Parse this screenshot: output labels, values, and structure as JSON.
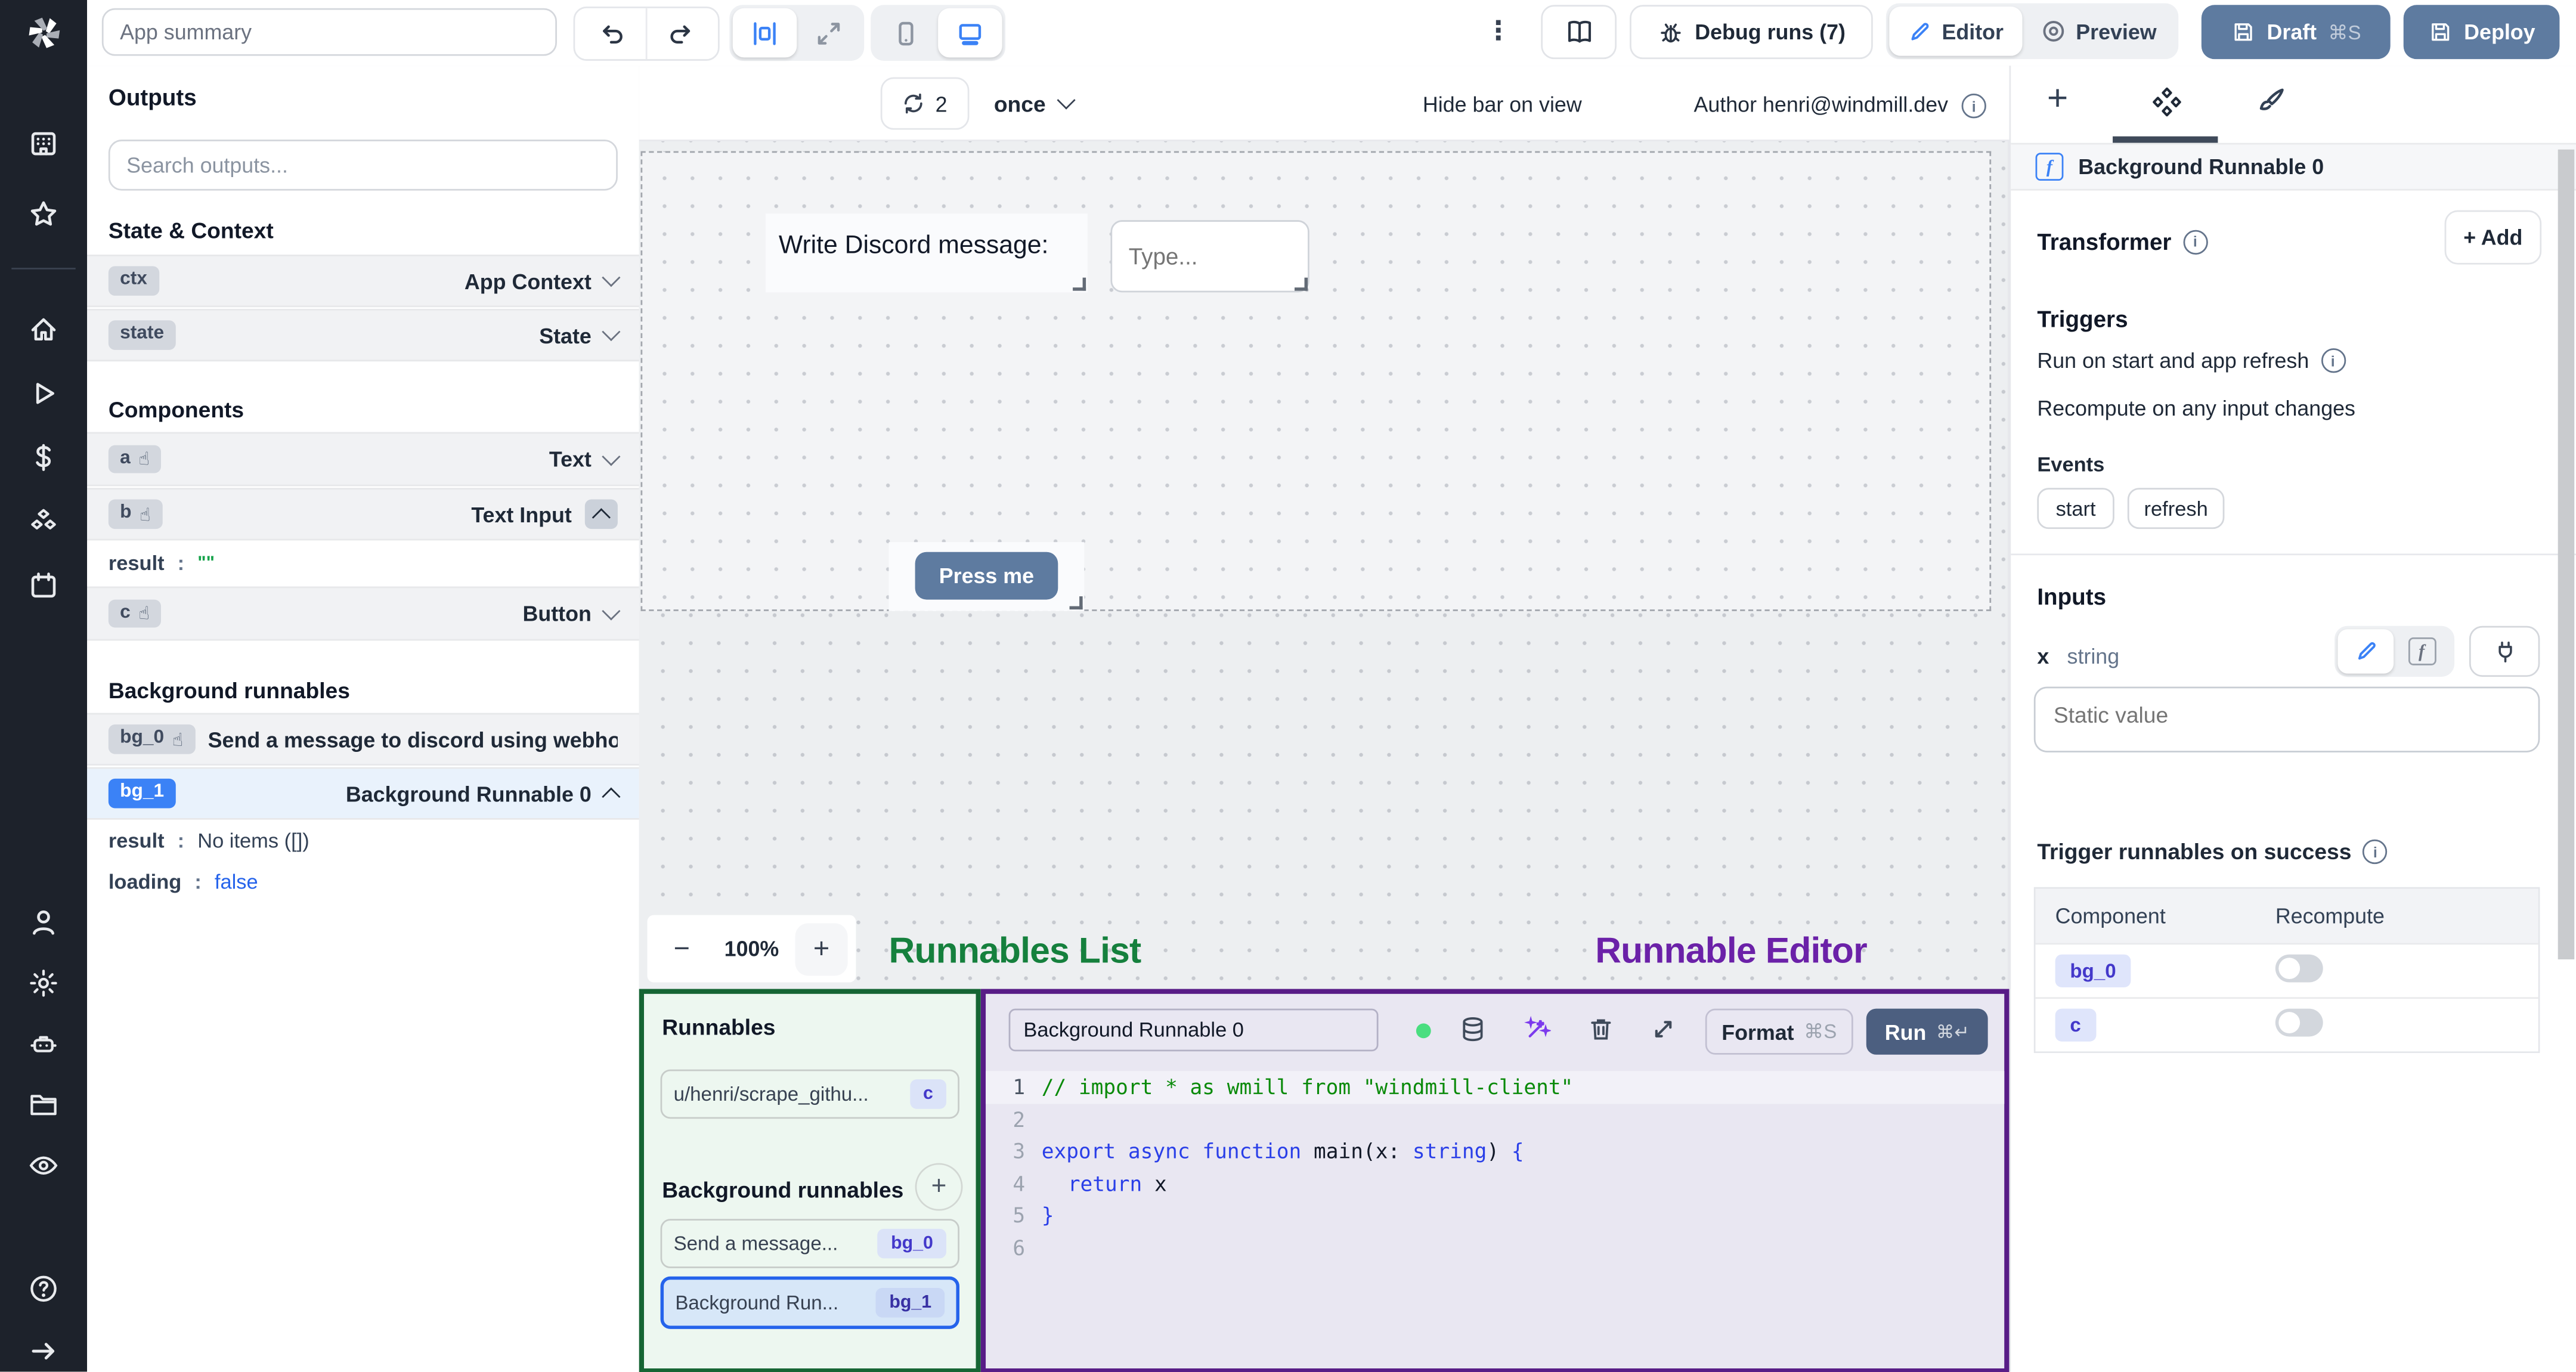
{
  "symbols": {
    "plus": "+",
    "minus": "−",
    "kebab": "⋮",
    "hand": "☝",
    "colon": ":"
  },
  "topbar": {
    "app_summary_placeholder": "App summary",
    "debug_runs": "Debug runs (7)",
    "editor": "Editor",
    "preview": "Preview",
    "draft": "Draft",
    "draft_shortcut": "⌘S",
    "deploy": "Deploy"
  },
  "canvas_toolbar": {
    "refresh_count": "2",
    "mode": "once",
    "hide_bar_label": "Hide bar on view",
    "author": "Author henri@windmill.dev"
  },
  "outputs": {
    "title": "Outputs",
    "search_placeholder": "Search outputs...",
    "state_context_title": "State & Context",
    "rows": [
      {
        "badge": "ctx",
        "label": "App Context"
      },
      {
        "badge": "state",
        "label": "State"
      }
    ],
    "components_title": "Components",
    "comp_rows": [
      {
        "badge": "a",
        "label": "Text"
      },
      {
        "badge": "b",
        "label": "Text Input"
      },
      {
        "badge": "c",
        "label": "Button"
      }
    ],
    "b_result_key": "result",
    "b_result_value": "\"\"",
    "bg_title": "Background runnables",
    "bg0_badge": "bg_0",
    "bg0_label": "Send a message to discord using webhoo",
    "bg1_badge": "bg_1",
    "bg1_label": "Background Runnable 0",
    "bg1_result_key": "result",
    "bg1_result_value": "No items ([])",
    "bg1_loading_key": "loading",
    "bg1_loading_value": "false"
  },
  "canvas": {
    "text_component": "Write Discord message:",
    "input_placeholder": "Type...",
    "button_label": "Press me",
    "zoom_level": "100%"
  },
  "annotations": {
    "runnables_list": "Runnables List",
    "runnable_editor": "Runnable Editor"
  },
  "runnables_panel": {
    "title": "Runnables",
    "item1_label": "u/henri/scrape_githu...",
    "item1_badge": "c",
    "bg_title": "Background runnables",
    "item2_label": "Send a message...",
    "item2_badge": "bg_0",
    "item3_label": "Background Run...",
    "item3_badge": "bg_1"
  },
  "editor": {
    "name": "Background Runnable 0",
    "format": "Format",
    "format_shortcut": "⌘S",
    "run": "Run",
    "run_shortcut": "⌘↵",
    "line_numbers": [
      "1",
      "2",
      "3",
      "4",
      "5",
      "6"
    ],
    "code": {
      "l1": "// import * as wmill from \"windmill-client\"",
      "l3_k1": "export",
      "l3_k2": "async",
      "l3_k3": "function",
      "l3_fn": "main",
      "l3_p1": "(x:",
      "l3_type": "string",
      "l3_p2": ")",
      "l3_brace": "{",
      "l4_kw": "return",
      "l4_val": "x",
      "l5": "}"
    }
  },
  "right_panel": {
    "component_name": "Background Runnable 0",
    "transformer": "Transformer",
    "add_label": "+ Add",
    "triggers": "Triggers",
    "trigger1": "Run on start and app refresh",
    "trigger2": "Recompute on any input changes",
    "events": "Events",
    "event1": "start",
    "event2": "refresh",
    "inputs": "Inputs",
    "input_name": "x",
    "input_type": "string",
    "static_placeholder": "Static value",
    "trigger_success": "Trigger runnables on success",
    "table": {
      "col1": "Component",
      "col2": "Recompute",
      "row1_badge": "bg_0",
      "row2_badge": "c"
    }
  },
  "colors": {
    "accent": "#2563eb",
    "slate_button": "#5e7ba0",
    "run_button": "#4c5f80",
    "toggle_on": "#2563eb",
    "badge_indigo_bg": "#dbe3f8",
    "badge_indigo_text": "#4338ca",
    "annotation_green": "#15803d",
    "annotation_purple": "#6b21a8",
    "comment_green": "#0a8a0a",
    "keyword_blue": "#2a3fe8",
    "selected_badge": "#3b82f6"
  }
}
